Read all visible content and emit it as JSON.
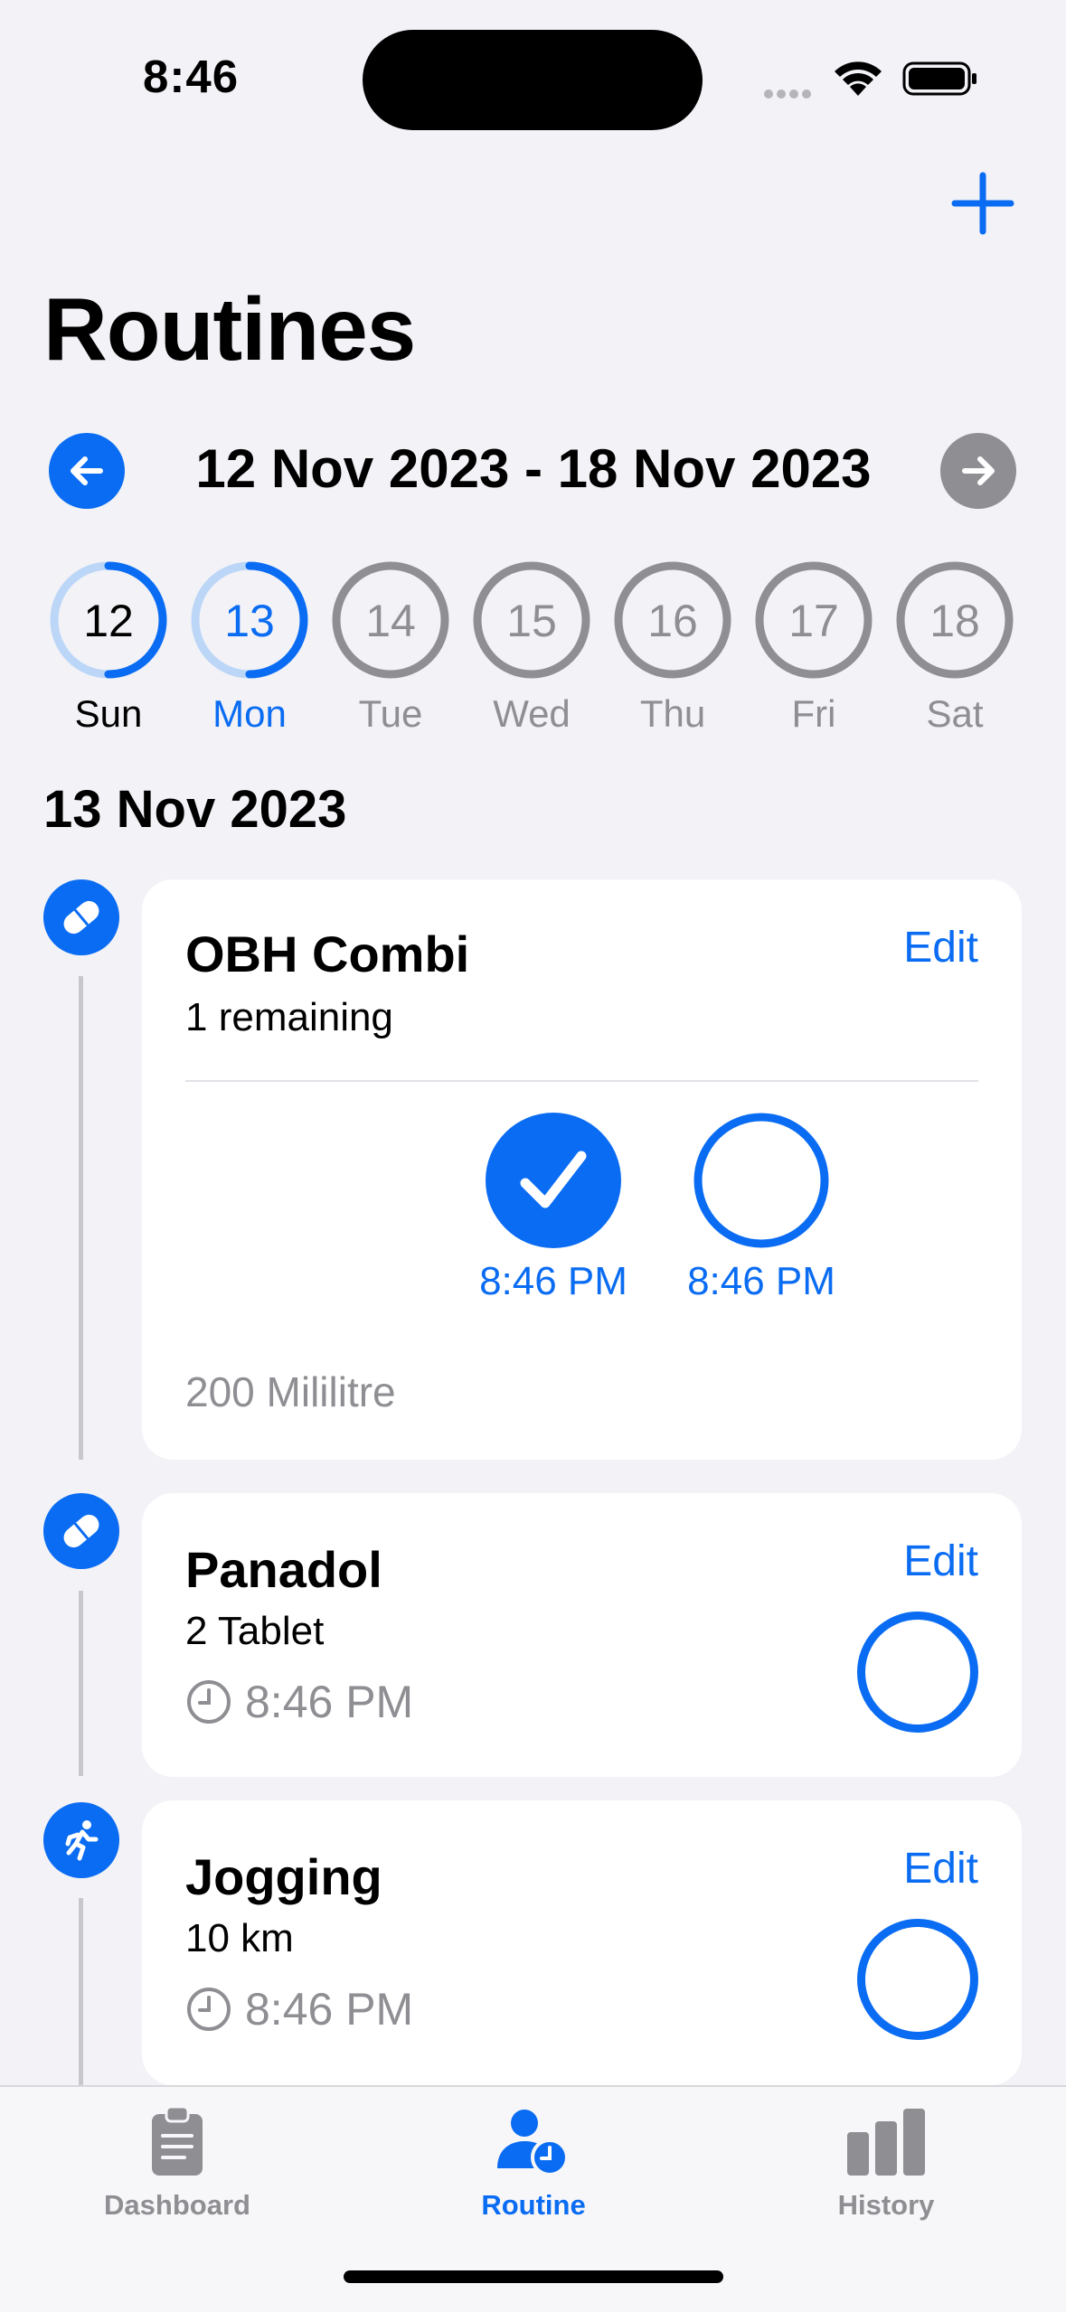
{
  "status": {
    "time": "8:46"
  },
  "header": {
    "title": "Routines"
  },
  "week": {
    "range": "12 Nov 2023 - 18 Nov 2023"
  },
  "days": [
    {
      "num": "12",
      "label": "Sun",
      "progress": 0.5,
      "state": "past"
    },
    {
      "num": "13",
      "label": "Mon",
      "progress": 0.5,
      "state": "selected"
    },
    {
      "num": "14",
      "label": "Tue",
      "progress": 0,
      "state": "future"
    },
    {
      "num": "15",
      "label": "Wed",
      "progress": 0,
      "state": "future"
    },
    {
      "num": "16",
      "label": "Thu",
      "progress": 0,
      "state": "future"
    },
    {
      "num": "17",
      "label": "Fri",
      "progress": 0,
      "state": "future"
    },
    {
      "num": "18",
      "label": "Sat",
      "progress": 0,
      "state": "future"
    }
  ],
  "selected_date": "13 Nov 2023",
  "routines": [
    {
      "icon": "pill-icon",
      "title": "OBH Combi",
      "subtitle": "1 remaining",
      "edit": "Edit",
      "doses": [
        {
          "time": "8:46 PM",
          "done": true
        },
        {
          "time": "8:46 PM",
          "done": false
        }
      ],
      "amount": "200 Mililitre"
    },
    {
      "icon": "pill-icon",
      "title": "Panadol",
      "subtitle": "2 Tablet",
      "time": "8:46 PM",
      "edit": "Edit",
      "done": false
    },
    {
      "icon": "running-icon",
      "title": "Jogging",
      "subtitle": "10 km",
      "time": "8:46 PM",
      "edit": "Edit",
      "done": false
    }
  ],
  "tabs": [
    {
      "label": "Dashboard",
      "icon": "clipboard-icon",
      "active": false
    },
    {
      "label": "Routine",
      "icon": "person-clock-icon",
      "active": true
    },
    {
      "label": "History",
      "icon": "bar-chart-icon",
      "active": false
    }
  ],
  "colors": {
    "accent": "#0a6cf2",
    "inactive": "#8e8e93",
    "background": "#f2f2f7"
  }
}
